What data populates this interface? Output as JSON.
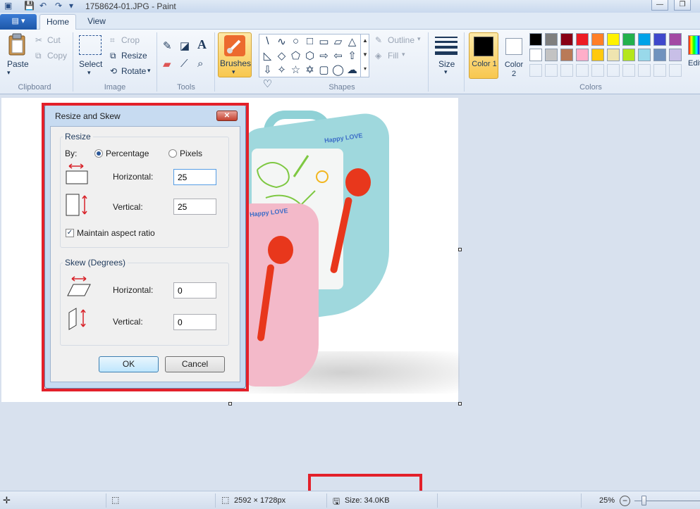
{
  "window": {
    "title": "1758624-01.JPG - Paint",
    "minimize_glyph": "—",
    "restore_glyph": "❐"
  },
  "tabs": {
    "file_menu_glyph": "▤ ▾",
    "home": "Home",
    "view": "View"
  },
  "ribbon": {
    "clipboard": {
      "label": "Clipboard",
      "paste": "Paste",
      "cut": "Cut",
      "copy": "Copy"
    },
    "image": {
      "label": "Image",
      "select": "Select",
      "crop": "Crop",
      "resize": "Resize",
      "rotate": "Rotate"
    },
    "tools": {
      "label": "Tools"
    },
    "brushes": "Brushes",
    "shapes": {
      "label": "Shapes",
      "outline": "Outline",
      "fill": "Fill",
      "icons": [
        "\\",
        "∿",
        "○",
        "□",
        "▭",
        "▱",
        "△",
        "◺",
        "◇",
        "⬠",
        "⬡",
        "⇨",
        "⇦",
        "⇧",
        "⇩",
        "✧",
        "☆",
        "✡",
        "▢",
        "◯",
        "☁",
        "♡"
      ]
    },
    "size": "Size",
    "colors": {
      "label": "Colors",
      "color1": "Color 1",
      "color2": "Color 2",
      "edit": "Edit colors",
      "color1_value": "#000000",
      "color2_value": "#ffffff",
      "palette_row1": [
        "#000000",
        "#7f7f7f",
        "#880015",
        "#ed1c24",
        "#ff7f27",
        "#fff200",
        "#22b14c",
        "#00a2e8",
        "#3f48cc",
        "#a349a4"
      ],
      "palette_row2": [
        "#ffffff",
        "#c3c3c3",
        "#b97a57",
        "#ffaec9",
        "#ffc90e",
        "#efe4b0",
        "#b5e61d",
        "#99d9ea",
        "#7092be",
        "#c8bfe7"
      ]
    }
  },
  "dialog": {
    "title": "Resize and Skew",
    "resize_section": "Resize",
    "by_label": "By:",
    "percentage": "Percentage",
    "pixels": "Pixels",
    "horizontal_label": "Horizontal:",
    "horizontal_value": "25",
    "vertical_label": "Vertical:",
    "vertical_value": "25",
    "maintain_aspect": "Maintain aspect ratio",
    "skew_section": "Skew (Degrees)",
    "skew_horizontal_label": "Horizontal:",
    "skew_horizontal_value": "0",
    "skew_vertical_label": "Vertical:",
    "skew_vertical_value": "0",
    "ok": "OK",
    "cancel": "Cancel"
  },
  "image_text": {
    "happy_love_1": "Happy LOVE",
    "happy_love_2": "Happy LOVE"
  },
  "statusbar": {
    "dimensions": "2592 × 1728px",
    "size": "Size: 34.0KB",
    "zoom": "25%",
    "zoom_out_glyph": "−"
  }
}
